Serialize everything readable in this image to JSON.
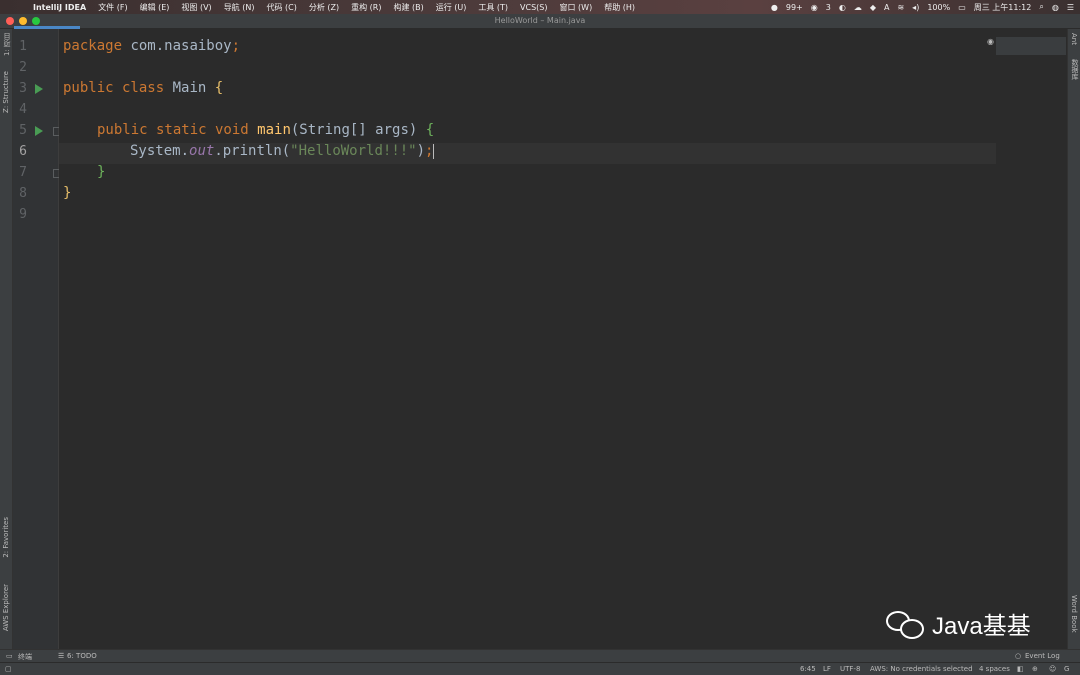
{
  "menubar": {
    "app": "IntelliJ IDEA",
    "items": [
      "文件 (F)",
      "编辑 (E)",
      "视图 (V)",
      "导航 (N)",
      "代码 (C)",
      "分析 (Z)",
      "重构 (R)",
      "构建 (B)",
      "运行 (U)",
      "工具 (T)",
      "VCS(S)",
      "窗口 (W)",
      "帮助 (H)"
    ],
    "notifications": "99+",
    "wechat_count": "3",
    "battery": "100%",
    "clock": "周三 上午11:12"
  },
  "window": {
    "title": "HelloWorld – Main.java"
  },
  "left_tools": {
    "project": "1: 项目",
    "structure": "Z: Structure",
    "favorites": "2: Favorites",
    "aws": "AWS Explorer"
  },
  "right_tools": {
    "ant": "Ant",
    "database": "数据库",
    "wordbook": "Word Book"
  },
  "editor": {
    "line_numbers": [
      "1",
      "2",
      "3",
      "4",
      "5",
      "6",
      "7",
      "8",
      "9"
    ],
    "code": {
      "l1_kw": "package",
      "l1_rest": " com.nasaiboy",
      "l1_semi": ";",
      "l3_kw": "public class",
      "l3_name": " Main ",
      "l3_brace": "{",
      "l5_kw": "public static void",
      "l5_sp": " ",
      "l5_fn": "main",
      "l5_args": "(String[] args) ",
      "l5_brace": "{",
      "l6_a": "System.",
      "l6_out": "out",
      "l6_b": ".println(",
      "l6_str": "\"HelloWorld!!!\"",
      "l6_c": ")",
      "l6_semi": ";",
      "l7_brace": "}",
      "l8_brace": "}"
    }
  },
  "bottom_tools": {
    "terminal": "终端",
    "todo": "6: TODO",
    "event_log": "Event Log"
  },
  "status": {
    "position": "6:45",
    "line_sep": "LF",
    "encoding": "UTF-8",
    "aws": "AWS: No credentials selected",
    "indent": "4 spaces"
  },
  "watermark": {
    "text": "Java基基"
  }
}
